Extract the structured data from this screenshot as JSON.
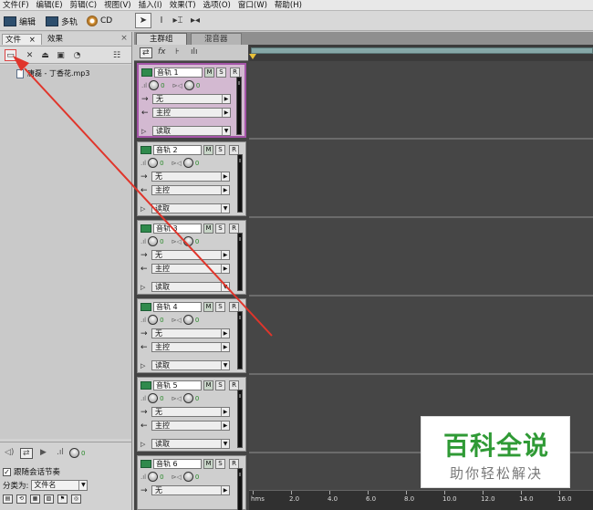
{
  "menu": [
    "文件(F)",
    "编辑(E)",
    "剪辑(C)",
    "视图(V)",
    "插入(I)",
    "效果(T)",
    "选项(O)",
    "窗口(W)",
    "帮助(H)"
  ],
  "workspace": {
    "edit_label": "编辑",
    "multitrack_label": "多轨",
    "cd_label": "CD"
  },
  "left_panel": {
    "tab_files": "文件",
    "tab_files_close": "×",
    "tab_effects": "效果",
    "panel_close": "×",
    "file_name": "唐磊 - 丁香花.mp3",
    "knob_value": "0",
    "loop_label": "跟随会话节奏",
    "sort_label": "分类为:",
    "sort_value": "文件名"
  },
  "track_panel": {
    "tab_main": "主群组",
    "tab_mixer": "混音器"
  },
  "tracks": [
    {
      "name": "音轨 1",
      "vol": "0",
      "pan": "0",
      "input": "无",
      "output": "主控",
      "auto": "读取"
    },
    {
      "name": "音轨 2",
      "vol": "0",
      "pan": "0",
      "input": "无",
      "output": "主控",
      "auto": "读取"
    },
    {
      "name": "音轨 3",
      "vol": "0",
      "pan": "0",
      "input": "无",
      "output": "主控",
      "auto": "读取"
    },
    {
      "name": "音轨 4",
      "vol": "0",
      "pan": "0",
      "input": "无",
      "output": "主控",
      "auto": "读取"
    },
    {
      "name": "音轨 5",
      "vol": "0",
      "pan": "0",
      "input": "无",
      "output": "主控",
      "auto": "读取"
    },
    {
      "name": "音轨 6",
      "vol": "0",
      "pan": "0",
      "input": "无"
    }
  ],
  "track_buttons": {
    "mute": "M",
    "solo": "S",
    "record": "R"
  },
  "timeline": {
    "ticks": [
      "hms",
      "2.0",
      "4.0",
      "6.0",
      "8.0",
      "10.0",
      "12.0",
      "14.0",
      "16.0"
    ]
  },
  "watermark": {
    "title": "百科全说",
    "subtitle": "助你轻松解决"
  },
  "colors": {
    "selected_track": "#d3b9d1",
    "selected_border": "#a454a8",
    "arrow": "#e0352b",
    "watermark_green": "#2f9a35"
  }
}
